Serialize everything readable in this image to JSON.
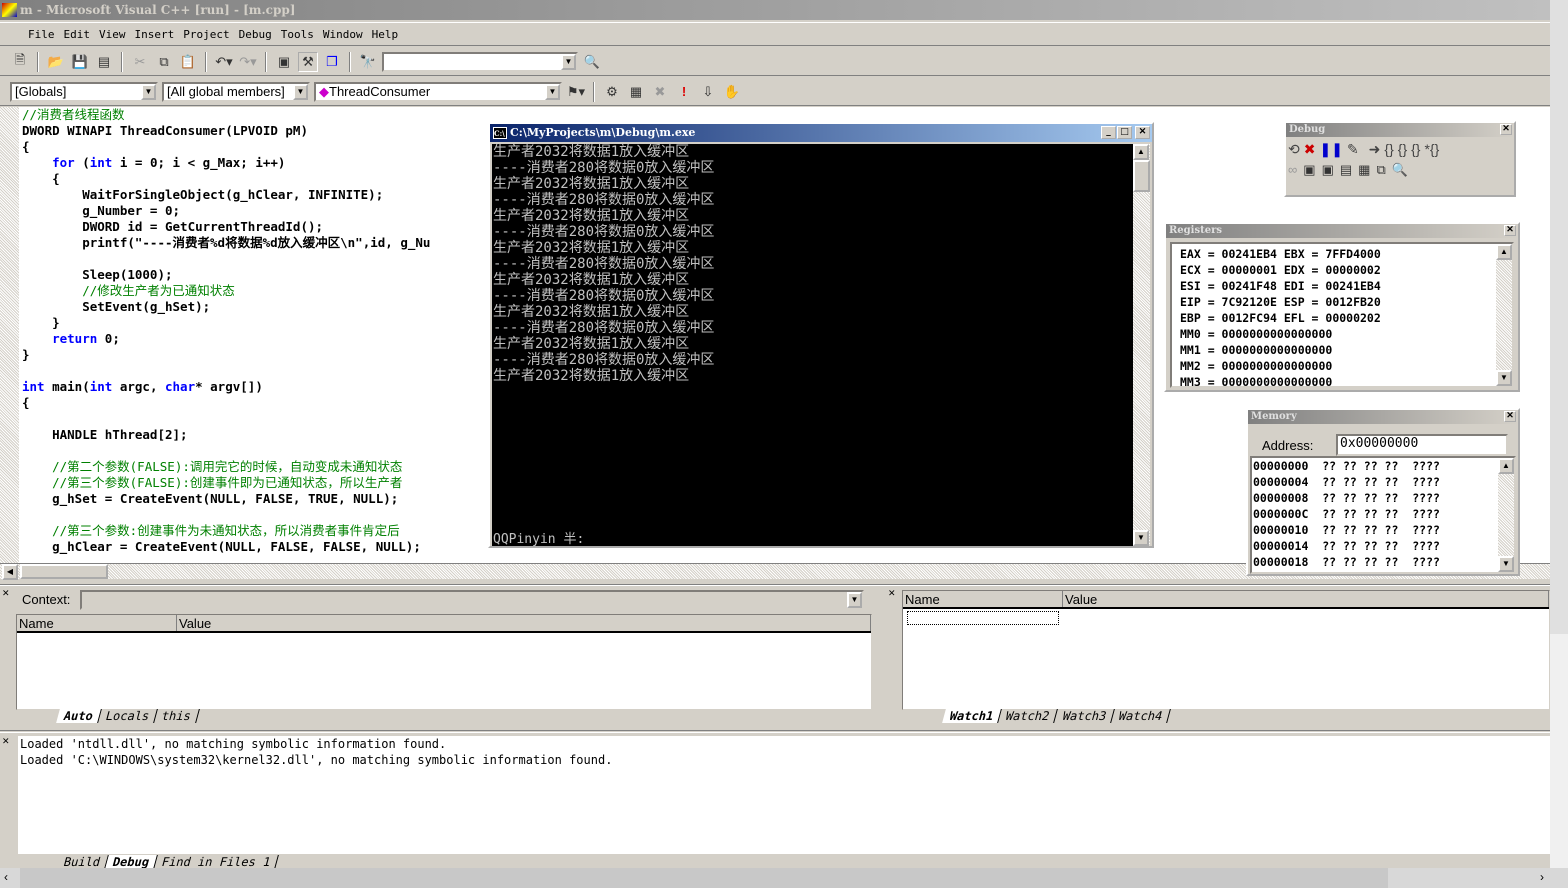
{
  "window": {
    "title": "m - Microsoft Visual C++ [run] - [m.cpp]"
  },
  "menu": [
    "File",
    "Edit",
    "View",
    "Insert",
    "Project",
    "Debug",
    "Tools",
    "Window",
    "Help"
  ],
  "toolbar": {
    "find_value": "",
    "icons": [
      "new-text-file",
      "open",
      "save",
      "save-all",
      "cut",
      "copy",
      "paste",
      "undo",
      "redo",
      "workspace",
      "output",
      "window-list",
      "find-in-files"
    ]
  },
  "wizardbar": {
    "scope": "[Globals]",
    "filter": "[All global members]",
    "member": "ThreadConsumer",
    "icons": [
      "wizard-action",
      "compile",
      "build",
      "stop-build",
      "execute",
      "go",
      "breakpoint"
    ]
  },
  "editor": {
    "lines": [
      [
        [
          "//消费者线程函数",
          "c"
        ]
      ],
      [
        [
          "DWORD WINAPI ThreadConsumer(LPVOID pM)",
          "n"
        ]
      ],
      [
        [
          "{",
          "n"
        ]
      ],
      [
        [
          "    ",
          "n"
        ],
        [
          "for",
          "k"
        ],
        [
          " (",
          "n"
        ],
        [
          "int",
          "k"
        ],
        [
          " i = 0; i < g_Max; i++)",
          "n"
        ]
      ],
      [
        [
          "    {",
          "n"
        ]
      ],
      [
        [
          "        WaitForSingleObject(g_hClear, INFINITE);",
          "n"
        ]
      ],
      [
        [
          "        g_Number = 0;",
          "n"
        ]
      ],
      [
        [
          "        DWORD id = GetCurrentThreadId();",
          "n"
        ]
      ],
      [
        [
          "        printf(\"----消费者%d将数据%d放入缓冲区\\n\",id, g_Nu",
          "n"
        ]
      ],
      [
        [
          "",
          "n"
        ]
      ],
      [
        [
          "        Sleep(1000);",
          "n"
        ]
      ],
      [
        [
          "        ",
          "n"
        ],
        [
          "//修改生产者为已通知状态",
          "c"
        ]
      ],
      [
        [
          "        SetEvent(g_hSet);",
          "n"
        ]
      ],
      [
        [
          "    }",
          "n"
        ]
      ],
      [
        [
          "    ",
          "n"
        ],
        [
          "return",
          "k"
        ],
        [
          " 0;",
          "n"
        ]
      ],
      [
        [
          "}",
          "n"
        ]
      ],
      [
        [
          "",
          "n"
        ]
      ],
      [
        [
          "int",
          "k"
        ],
        [
          " main(",
          "n"
        ],
        [
          "int",
          "k"
        ],
        [
          " argc, ",
          "n"
        ],
        [
          "char",
          "k"
        ],
        [
          "* argv[])",
          "n"
        ]
      ],
      [
        [
          "{",
          "n"
        ]
      ],
      [
        [
          "",
          "n"
        ]
      ],
      [
        [
          "    HANDLE hThread[2];",
          "n"
        ]
      ],
      [
        [
          "",
          "n"
        ]
      ],
      [
        [
          "    ",
          "n"
        ],
        [
          "//第二个参数(FALSE):调用完它的时候，自动变成未通知状态",
          "c"
        ]
      ],
      [
        [
          "    ",
          "n"
        ],
        [
          "//第三个参数(FALSE):创建事件即为已通知状态，所以生产者",
          "c"
        ]
      ],
      [
        [
          "    g_hSet = CreateEvent(NULL, FALSE, TRUE, NULL);",
          "n"
        ]
      ],
      [
        [
          "",
          "n"
        ]
      ],
      [
        [
          "    ",
          "n"
        ],
        [
          "//第三个参数:创建事件为未通知状态，所以消费者事件肯定后",
          "c"
        ]
      ],
      [
        [
          "    g_hClear = CreateEvent(NULL, FALSE, FALSE, NULL);",
          "n"
        ]
      ]
    ]
  },
  "console": {
    "title": "C:\\MyProjects\\m\\Debug\\m.exe",
    "lines": [
      "生产者2032将数据1放入缓冲区",
      "----消费者280将数据0放入缓冲区",
      "生产者2032将数据1放入缓冲区",
      "----消费者280将数据0放入缓冲区",
      "生产者2032将数据1放入缓冲区",
      "----消费者280将数据0放入缓冲区",
      "生产者2032将数据1放入缓冲区",
      "----消费者280将数据0放入缓冲区",
      "生产者2032将数据1放入缓冲区",
      "----消费者280将数据0放入缓冲区",
      "生产者2032将数据1放入缓冲区",
      "----消费者280将数据0放入缓冲区",
      "生产者2032将数据1放入缓冲区",
      "----消费者280将数据0放入缓冲区",
      "生产者2032将数据1放入缓冲区"
    ],
    "ime": "QQPinyin 半:"
  },
  "debug_toolbar": {
    "title": "Debug"
  },
  "registers": {
    "title": "Registers",
    "lines": [
      "EAX = 00241EB4 EBX = 7FFD4000",
      "ECX = 00000001 EDX = 00000002",
      "ESI = 00241F48 EDI = 00241EB4",
      "EIP = 7C92120E ESP = 0012FB20",
      "EBP = 0012FC94 EFL = 00000202",
      "MM0 = 0000000000000000",
      "MM1 = 0000000000000000",
      "MM2 = 0000000000000000",
      "MM3 = 0000000000000000"
    ]
  },
  "memory": {
    "title": "Memory",
    "address_label": "Address:",
    "address": "0x00000000",
    "lines": [
      "00000000  ?? ?? ?? ??  ????",
      "00000004  ?? ?? ?? ??  ????",
      "00000008  ?? ?? ?? ??  ????",
      "0000000C  ?? ?? ?? ??  ????",
      "00000010  ?? ?? ?? ??  ????",
      "00000014  ?? ?? ?? ??  ????",
      "00000018  ?? ?? ?? ??  ????"
    ]
  },
  "variables": {
    "context_label": "Context:",
    "context": "",
    "col_name": "Name",
    "col_value": "Value",
    "tabs": [
      "Auto",
      "Locals",
      "this"
    ]
  },
  "watch": {
    "col_name": "Name",
    "col_value": "Value",
    "tabs": [
      "Watch1",
      "Watch2",
      "Watch3",
      "Watch4"
    ]
  },
  "output": {
    "lines": [
      "Loaded 'ntdll.dll', no matching symbolic information found.",
      "Loaded 'C:\\WINDOWS\\system32\\kernel32.dll', no matching symbolic information found."
    ],
    "tabs": [
      "Build",
      "Debug",
      "Find in Files 1"
    ]
  }
}
